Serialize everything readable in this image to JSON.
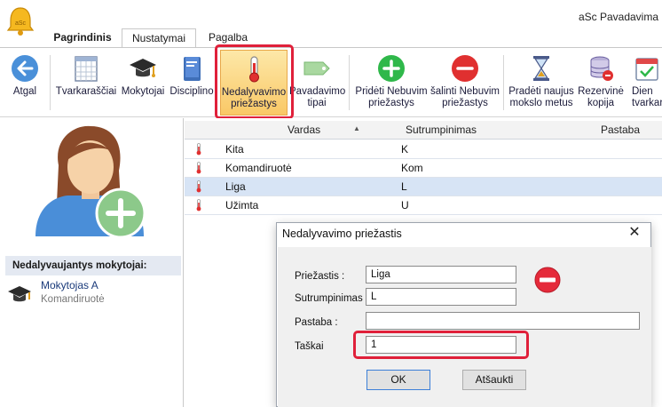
{
  "app": {
    "title": "aSc Pavadavima"
  },
  "tabs": [
    {
      "label": "Pagrindinis"
    },
    {
      "label": "Nustatymai"
    },
    {
      "label": "Pagalba"
    }
  ],
  "ribbon": {
    "buttons": [
      {
        "label": "Atgal",
        "icon": "back-arrow-icon"
      },
      {
        "label": "Tvarkaraščiai",
        "icon": "timetable-grid-icon"
      },
      {
        "label": "Mokytojai",
        "icon": "graduation-cap-icon"
      },
      {
        "label": "Disciplino",
        "icon": "book-icon"
      },
      {
        "label_line1": "Nedalyvavimo",
        "label_line2": "priežastys",
        "icon": "thermometer-icon",
        "active": true
      },
      {
        "label_line1": "Pavadavimo",
        "label_line2": "tipai",
        "icon": "tag-icon"
      },
      {
        "label_line1": "Pridėti Nebuvim",
        "label_line2": "priežastys",
        "icon": "plus-circle-icon"
      },
      {
        "label_line1": "šalinti Nebuvim",
        "label_line2": "priežastys",
        "icon": "minus-circle-icon"
      },
      {
        "label_line1": "Pradėti naujus",
        "label_line2": "mokslo metus",
        "icon": "hourglass-icon"
      },
      {
        "label_line1": "Rezervinė",
        "label_line2": "kopija",
        "icon": "database-icon"
      },
      {
        "label_line1": "Dien",
        "label_line2": "tvarkara",
        "icon": "calendar-check-icon"
      }
    ]
  },
  "left_pane": {
    "absent_header": "Nedalyvaujantys mokytojai:",
    "teachers": [
      {
        "name": "Mokytojas A",
        "reason": "Komandiruotė"
      }
    ]
  },
  "grid": {
    "headers": {
      "name": "Vardas",
      "abbr": "Sutrumpinimas",
      "note": "Pastaba"
    },
    "rows": [
      {
        "name": "Kita",
        "abbr": "K"
      },
      {
        "name": "Komandiruotė",
        "abbr": "Kom"
      },
      {
        "name": "Liga",
        "abbr": "L",
        "selected": true
      },
      {
        "name": "Užimta",
        "abbr": "U"
      }
    ]
  },
  "dialog": {
    "title": "Nedalyvavimo priežastis",
    "fields": {
      "reason_label": "Priežastis :",
      "reason_value": "Liga",
      "abbr_label": "Sutrumpinimas",
      "abbr_value": "L",
      "note_label": "Pastaba :",
      "note_value": "",
      "points_label": "Taškai",
      "points_value": "1"
    },
    "ok_label": "OK",
    "cancel_label": "Atšaukti"
  },
  "colors": {
    "highlight": "#e0203a",
    "selection": "#d7e4f5",
    "active_button": "#f9c866"
  }
}
